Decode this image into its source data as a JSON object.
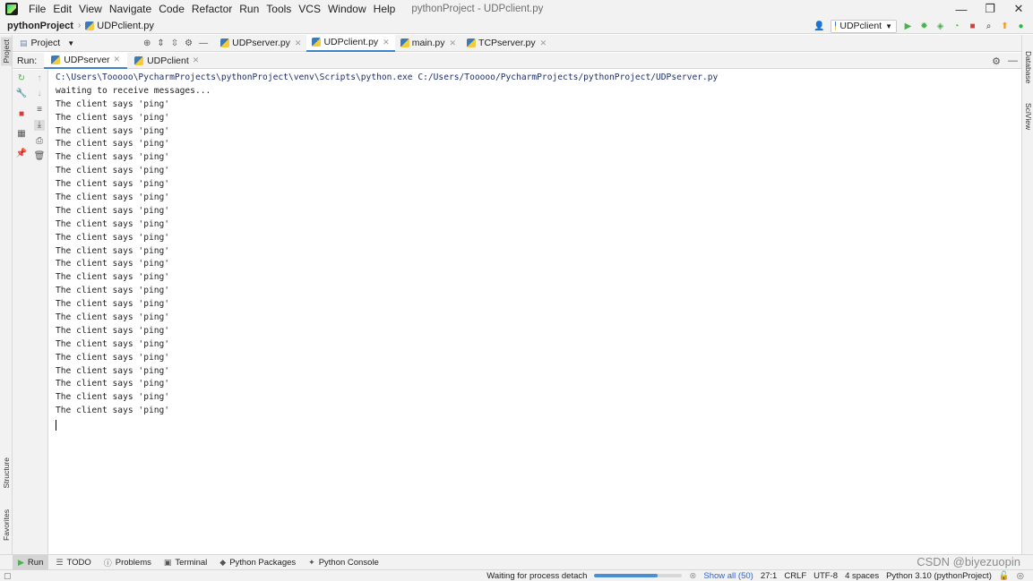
{
  "window": {
    "title": "pythonProject - UDPclient.py",
    "minimize_glyph": "—",
    "restore_glyph": "❐",
    "close_glyph": "✕"
  },
  "menu": [
    "File",
    "Edit",
    "View",
    "Navigate",
    "Code",
    "Refactor",
    "Run",
    "Tools",
    "VCS",
    "Window",
    "Help"
  ],
  "breadcrumb": {
    "root": "pythonProject",
    "file": "UDPclient.py"
  },
  "run_config": {
    "selected": "UDPclient"
  },
  "left_strip": {
    "project": "Project",
    "structure": "Structure",
    "favorites": "Favorites"
  },
  "right_strip": {
    "database": "Database",
    "sciview": "SciView"
  },
  "project_panel": {
    "label": "Project"
  },
  "editor_tabs": [
    {
      "label": "UDPserver.py",
      "active": false
    },
    {
      "label": "UDPclient.py",
      "active": true
    },
    {
      "label": "main.py",
      "active": false
    },
    {
      "label": "TCPserver.py",
      "active": false
    }
  ],
  "run_panel": {
    "label": "Run:",
    "tabs": [
      {
        "label": "UDPserver",
        "active": true
      },
      {
        "label": "UDPclient",
        "active": false
      }
    ]
  },
  "console": {
    "command": "C:\\Users\\Tooooo\\PycharmProjects\\pythonProject\\venv\\Scripts\\python.exe C:/Users/Tooooo/PycharmProjects/pythonProject/UDPserver.py",
    "status_line": "waiting to receive messages...",
    "output_lines": [
      "The client says 'ping'",
      "The client says 'ping'",
      "The client says 'ping'",
      "The client says 'ping'",
      "The client says 'ping'",
      "The client says 'ping'",
      "The client says 'ping'",
      "The client says 'ping'",
      "The client says 'ping'",
      "The client says 'ping'",
      "The client says 'ping'",
      "The client says 'ping'",
      "The client says 'ping'",
      "The client says 'ping'",
      "The client says 'ping'",
      "The client says 'ping'",
      "The client says 'ping'",
      "The client says 'ping'",
      "The client says 'ping'",
      "The client says 'ping'",
      "The client says 'ping'",
      "The client says 'ping'",
      "The client says 'ping'",
      "The client says 'ping'"
    ]
  },
  "bottom_tools": [
    {
      "label": "Run",
      "icon": "play-icon",
      "active": true
    },
    {
      "label": "TODO",
      "icon": "list-icon",
      "active": false
    },
    {
      "label": "Problems",
      "icon": "info-icon",
      "active": false
    },
    {
      "label": "Terminal",
      "icon": "terminal-icon",
      "active": false
    },
    {
      "label": "Python Packages",
      "icon": "packages-icon",
      "active": false
    },
    {
      "label": "Python Console",
      "icon": "python-icon",
      "active": false
    }
  ],
  "status_bar": {
    "process_text": "Waiting for process detach",
    "progress_fraction": 0.72,
    "show_all": "Show all (50)",
    "position": "27:1",
    "line_ending": "CRLF",
    "encoding": "UTF-8",
    "indent": "4 spaces",
    "interpreter": "Python 3.10 (pythonProject)"
  },
  "event_log": "Event Log",
  "watermark": "CSDN @biyezuopin",
  "colors": {
    "accent": "#4083c9",
    "stop_red": "#db3a3a",
    "run_green": "#4caf50",
    "link": "#2f65ca"
  }
}
